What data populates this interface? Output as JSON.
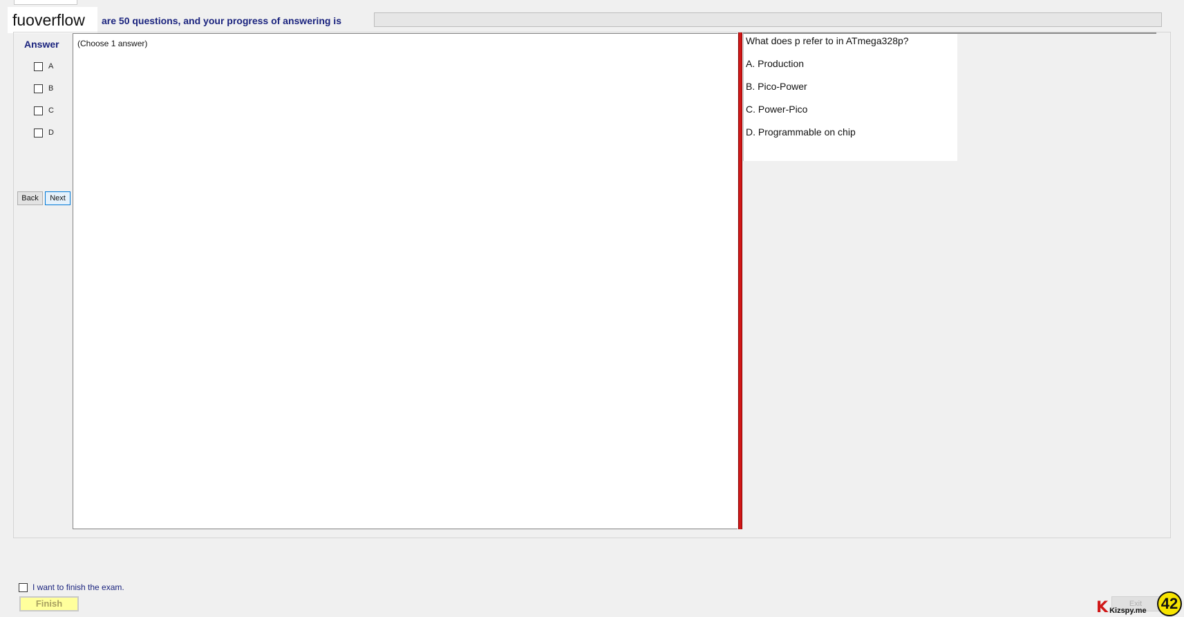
{
  "header": {
    "overlay_text": "fuoverflow",
    "progress_label": "are 50 questions, and your progress of answering is",
    "progress_fraction": 0
  },
  "answer_panel": {
    "title": "Answer",
    "options": [
      "A",
      "B",
      "C",
      "D"
    ],
    "back_label": "Back",
    "next_label": "Next"
  },
  "content": {
    "instruction": "(Choose 1 answer)"
  },
  "question": {
    "text": "What does p refer to in ATmega328p?",
    "options": [
      "A.  Production",
      "B.  Pico-Power",
      "C.  Power-Pico",
      "D.  Programmable on chip"
    ]
  },
  "footer": {
    "finish_checkbox_label": "I want to finish the exam.",
    "finish_label": "Finish",
    "exit_label": "Exit",
    "logo_text": "Kizspy.me",
    "logo_letter": "K",
    "count_badge": "42"
  },
  "colors": {
    "accent_text": "#1a237e",
    "splitter": "#d01818",
    "finish_bg": "#ffff9c",
    "badge": "#f7e400"
  }
}
